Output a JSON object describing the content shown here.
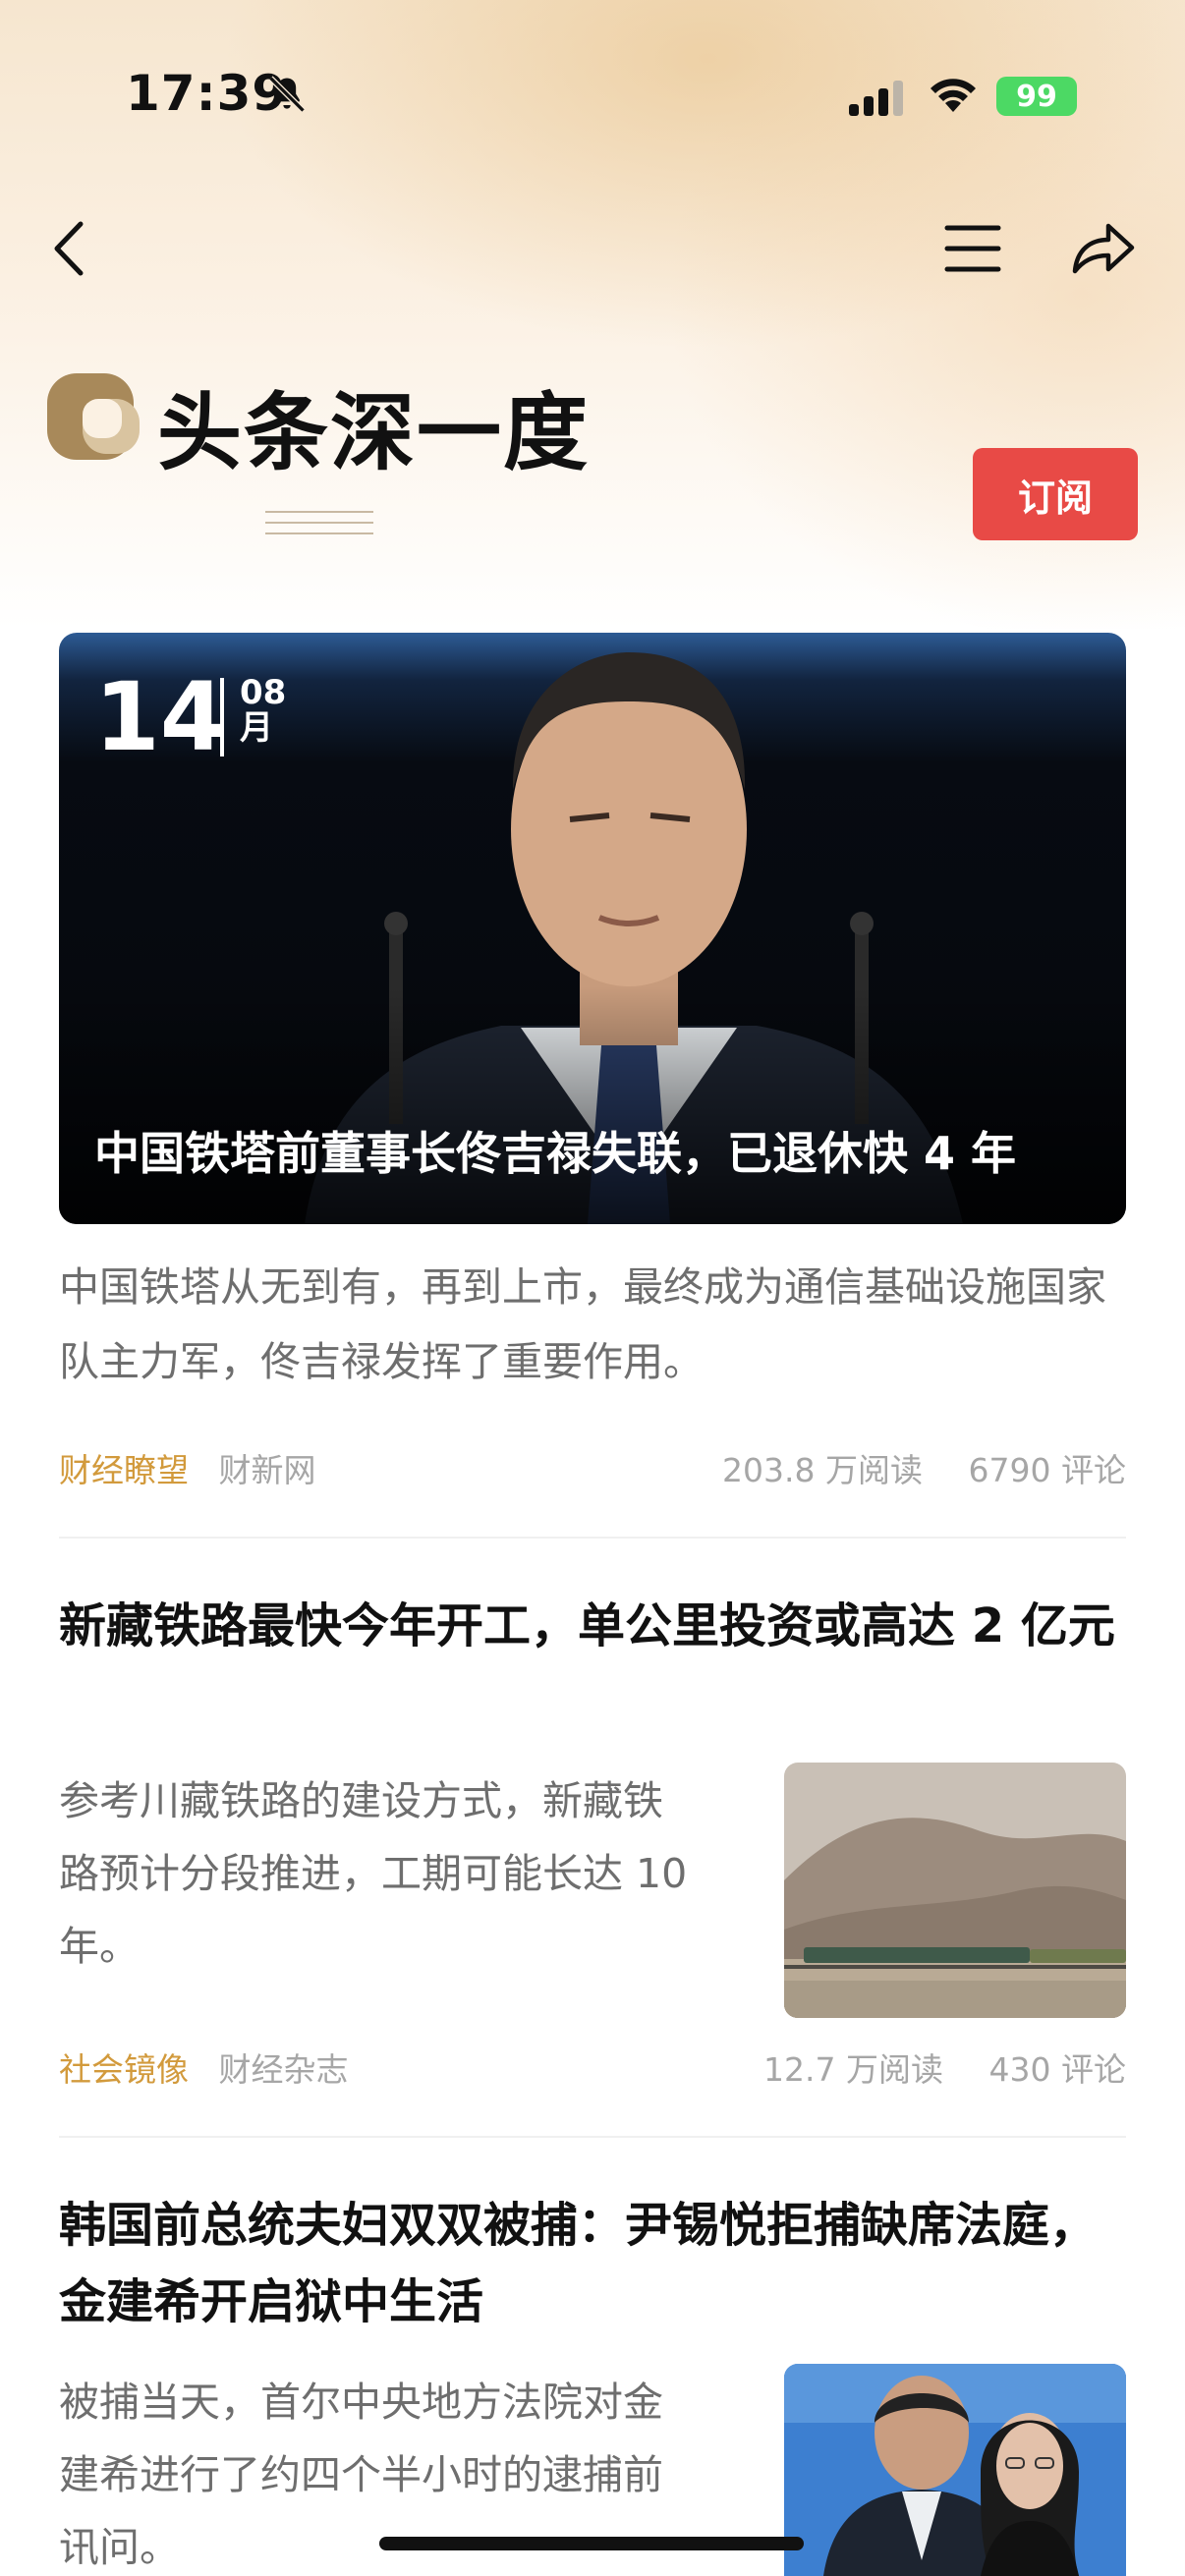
{
  "status_bar": {
    "time": "17:39",
    "battery": "99"
  },
  "brand": {
    "title": "头条深一度",
    "subscribe_label": "订阅"
  },
  "hero": {
    "day": "14",
    "month_num": "08",
    "month_unit": "月",
    "title": "中国铁塔前董事长佟吉禄失联，已退休快 4 年",
    "description": "中国铁塔从无到有，再到上市，最终成为通信基础设施国家队主力军，佟吉禄发挥了重要作用。",
    "tag": "财经瞭望",
    "source": "财新网",
    "reads": "203.8 万阅读",
    "comments": "6790 评论"
  },
  "articles": [
    {
      "title": "新藏铁路最快今年开工，单公里投资或高达 2 亿元",
      "description": "参考川藏铁路的建设方式，新藏铁路预计分段推进，工期可能长达 10 年。",
      "tag": "社会镜像",
      "source": "财经杂志",
      "reads": "12.7 万阅读",
      "comments": "430 评论"
    },
    {
      "title": "韩国前总统夫妇双双被捕：尹锡悦拒捕缺席法庭，金建希开启狱中生活",
      "description": "被捕当天，首尔中央地方法院对金建希进行了约四个半小时的逮捕前讯问。"
    }
  ]
}
